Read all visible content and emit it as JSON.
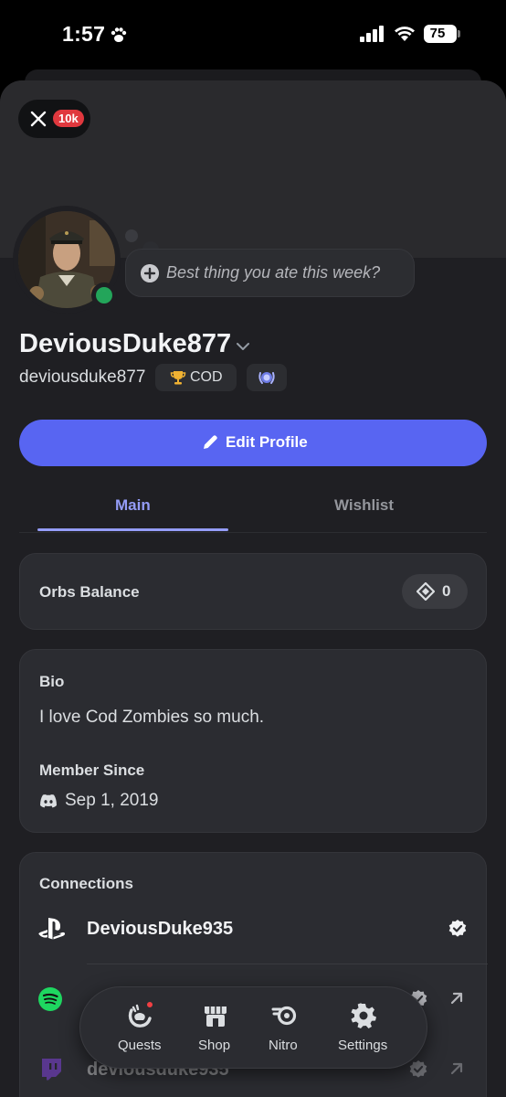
{
  "status_bar": {
    "time": "1:57",
    "battery": "75"
  },
  "header": {
    "notification_count": "10k"
  },
  "profile": {
    "status_prompt": "Best thing you ate this week?",
    "display_name": "DeviousDuke877",
    "username": "deviousduke877",
    "tag": "COD",
    "online_color": "#23a55a",
    "edit_button": "Edit Profile"
  },
  "tabs": [
    {
      "label": "Main",
      "active": true
    },
    {
      "label": "Wishlist",
      "active": false
    }
  ],
  "orbs": {
    "label": "Orbs Balance",
    "value": "0"
  },
  "bio": {
    "heading": "Bio",
    "text": "I love Cod Zombies so much.",
    "member_heading": "Member Since",
    "member_date": "Sep 1, 2019"
  },
  "connections": {
    "heading": "Connections",
    "items": [
      {
        "service": "playstation-icon",
        "name": "DeviousDuke935",
        "verified": true,
        "external": false
      },
      {
        "service": "spotify-icon",
        "name": "",
        "verified": true,
        "external": true
      },
      {
        "service": "twitch-icon",
        "name": "deviousduke935",
        "verified": true,
        "external": true
      }
    ]
  },
  "nav": {
    "items": [
      {
        "label": "Quests",
        "icon": "quests-icon",
        "has_alert": true
      },
      {
        "label": "Shop",
        "icon": "shop-icon",
        "has_alert": false
      },
      {
        "label": "Nitro",
        "icon": "nitro-icon",
        "has_alert": false
      },
      {
        "label": "Settings",
        "icon": "gear-icon",
        "has_alert": false
      }
    ]
  },
  "colors": {
    "accent": "#5865f2",
    "tab_active": "#949cf7",
    "alert": "#f23f43"
  }
}
